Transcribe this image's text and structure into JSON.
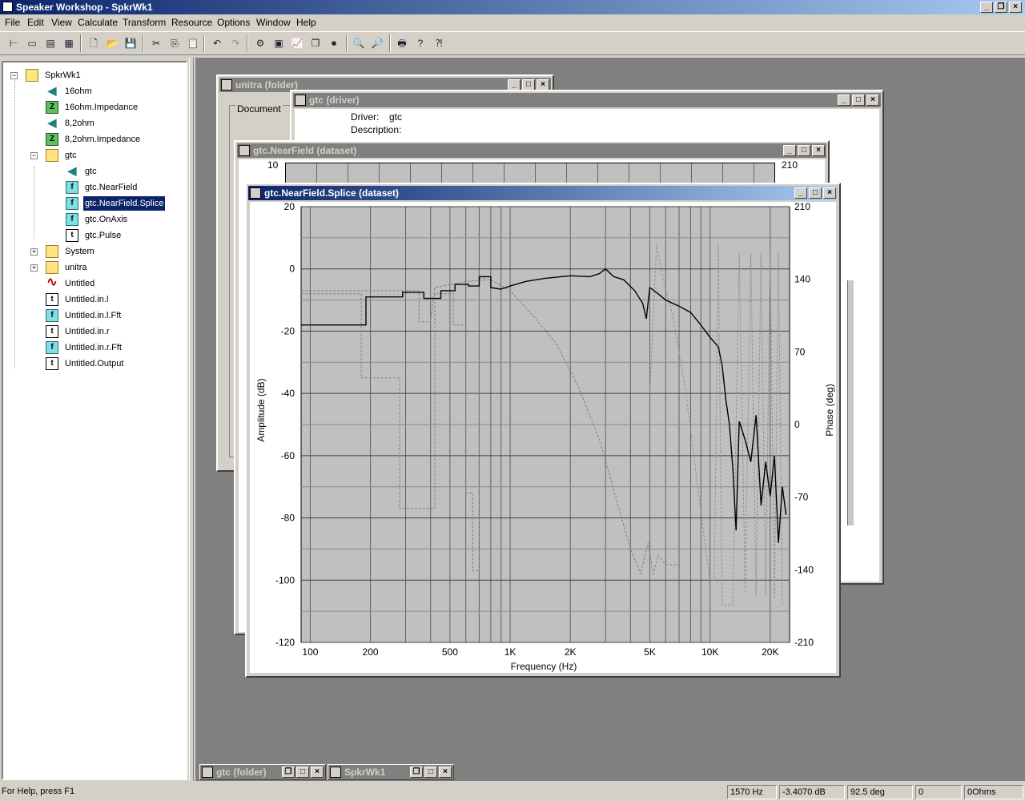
{
  "app": {
    "title": "Speaker Workshop - SpkrWk1"
  },
  "menu": [
    "File",
    "Edit",
    "View",
    "Calculate",
    "Transform",
    "Resource",
    "Options",
    "Window",
    "Help"
  ],
  "caption_buttons": {
    "min": "_",
    "max": "□",
    "close": "×",
    "restore": "❐"
  },
  "toolbar_icons": [
    "tree-view-icon",
    "list-view-icon",
    "details-view-icon",
    "small-icons-icon",
    "new-file-icon",
    "open-file-icon",
    "save-icon",
    "cut-icon",
    "copy-icon",
    "paste-icon",
    "undo-icon",
    "redo-icon",
    "calculate-icon",
    "measure-icon",
    "graph-icon",
    "windows-icon",
    "record-icon",
    "zoom-in-icon",
    "zoom-out-icon",
    "print-icon",
    "help-icon",
    "context-help-icon"
  ],
  "tree": {
    "root": "SpkrWk1",
    "items": [
      {
        "label": "16ohm",
        "icon": "speaker-icon"
      },
      {
        "label": "16ohm.Impedance",
        "icon": "impedance-icon"
      },
      {
        "label": "8,2ohm",
        "icon": "speaker-icon"
      },
      {
        "label": "8,2ohm.Impedance",
        "icon": "impedance-icon"
      },
      {
        "label": "gtc",
        "icon": "folder-icon"
      },
      {
        "label": "gtc",
        "icon": "speaker-icon"
      },
      {
        "label": "gtc.NearField",
        "icon": "frequency-icon"
      },
      {
        "label": "gtc.NearField.Splice",
        "icon": "frequency-icon"
      },
      {
        "label": "gtc.OnAxis",
        "icon": "frequency-icon"
      },
      {
        "label": "gtc.Pulse",
        "icon": "time-icon"
      },
      {
        "label": "System",
        "icon": "folder-icon"
      },
      {
        "label": "unitra",
        "icon": "folder-icon"
      },
      {
        "label": "Untitled",
        "icon": "signal-icon"
      },
      {
        "label": "Untitled.in.l",
        "icon": "time-icon"
      },
      {
        "label": "Untitled.in.l.Fft",
        "icon": "frequency-icon"
      },
      {
        "label": "Untitled.in.r",
        "icon": "time-icon"
      },
      {
        "label": "Untitled.in.r.Fft",
        "icon": "frequency-icon"
      },
      {
        "label": "Untitled.Output",
        "icon": "time-icon"
      }
    ],
    "icon_letters": {
      "z": "Z",
      "f": "f",
      "t": "t",
      "spk": "◀",
      "wave": "∿"
    }
  },
  "windows": {
    "unitra": {
      "title": "unitra (folder)",
      "group_label": "Document"
    },
    "driver": {
      "title": "gtc (driver)",
      "driver_label": "Driver:",
      "driver_value": "gtc",
      "description_label": "Description:"
    },
    "nearfield": {
      "title": "gtc.NearField (dataset)",
      "y_top": "10",
      "phase_top": "210"
    },
    "splice": {
      "title": "gtc.NearField.Splice (dataset)"
    }
  },
  "chart_data": {
    "type": "line",
    "xlabel": "Frequency (Hz)",
    "ylabel": "Amplitude (dB)",
    "y2label": "Phase (deg)",
    "x_scale": "log",
    "xlim": [
      90,
      25000
    ],
    "ylim": [
      -120,
      20
    ],
    "y2lim": [
      -210,
      210
    ],
    "x_ticks": [
      {
        "v": 100,
        "l": "100"
      },
      {
        "v": 200,
        "l": "200"
      },
      {
        "v": 500,
        "l": "500"
      },
      {
        "v": 1000,
        "l": "1K"
      },
      {
        "v": 2000,
        "l": "2K"
      },
      {
        "v": 5000,
        "l": "5K"
      },
      {
        "v": 10000,
        "l": "10K"
      },
      {
        "v": 20000,
        "l": "20K"
      }
    ],
    "y_ticks": [
      "20",
      "0",
      "-20",
      "-40",
      "-60",
      "-80",
      "-100",
      "-120"
    ],
    "y2_ticks": [
      "210",
      "140",
      "70",
      "0",
      "-70",
      "-140",
      "-210"
    ],
    "grid": true,
    "series": [
      {
        "style": "solid",
        "color": "#000000",
        "points": [
          [
            90,
            -18
          ],
          [
            190,
            -18
          ],
          [
            190,
            -9
          ],
          [
            290,
            -9
          ],
          [
            290,
            -7.5
          ],
          [
            370,
            -7.5
          ],
          [
            370,
            -9.5
          ],
          [
            450,
            -9.5
          ],
          [
            450,
            -7
          ],
          [
            530,
            -7
          ],
          [
            530,
            -5
          ],
          [
            620,
            -5
          ],
          [
            620,
            -5.5
          ],
          [
            700,
            -5.5
          ],
          [
            700,
            -2.5
          ],
          [
            800,
            -2.5
          ],
          [
            800,
            -6
          ],
          [
            900,
            -6.5
          ],
          [
            1000,
            -5.5
          ],
          [
            1200,
            -4
          ],
          [
            1500,
            -3
          ],
          [
            2000,
            -2.2
          ],
          [
            2500,
            -2.5
          ],
          [
            2800,
            -1.5
          ],
          [
            3000,
            0
          ],
          [
            3300,
            -2.5
          ],
          [
            3700,
            -3.5
          ],
          [
            4200,
            -7
          ],
          [
            4600,
            -11
          ],
          [
            4800,
            -16
          ],
          [
            5000,
            -6
          ],
          [
            5500,
            -8
          ],
          [
            6000,
            -10
          ],
          [
            7000,
            -12
          ],
          [
            8000,
            -14
          ],
          [
            9000,
            -18
          ],
          [
            10000,
            -22
          ],
          [
            11000,
            -25
          ],
          [
            11500,
            -31
          ],
          [
            12000,
            -42
          ],
          [
            12500,
            -50
          ],
          [
            13000,
            -64
          ],
          [
            13500,
            -84
          ],
          [
            14000,
            -49
          ],
          [
            15000,
            -55
          ],
          [
            16000,
            -62
          ],
          [
            17000,
            -47
          ],
          [
            18000,
            -76
          ],
          [
            19000,
            -62
          ],
          [
            20000,
            -73
          ],
          [
            21000,
            -60
          ],
          [
            22000,
            -88
          ],
          [
            23000,
            -70
          ],
          [
            24000,
            -79
          ]
        ]
      },
      {
        "style": "dashed",
        "color": "#808080",
        "points": [
          [
            90,
            -7
          ],
          [
            160,
            -7
          ],
          [
            350,
            -7
          ],
          [
            350,
            -17
          ],
          [
            400,
            -17
          ],
          [
            420,
            -6
          ],
          [
            600,
            -4
          ],
          [
            800,
            -3.5
          ],
          [
            1000,
            -7
          ],
          [
            1300,
            -15
          ],
          [
            1700,
            -24
          ],
          [
            2200,
            -38
          ],
          [
            2800,
            -55
          ],
          [
            3400,
            -74
          ],
          [
            4000,
            -90
          ],
          [
            4500,
            -98
          ],
          [
            4900,
            -88
          ],
          [
            5200,
            -98
          ],
          [
            5500,
            -92
          ],
          [
            6000,
            -95
          ],
          [
            7000,
            -95
          ]
        ]
      },
      {
        "style": "dashed",
        "color": "#808080",
        "points": [
          [
            90,
            -8
          ],
          [
            180,
            -8
          ],
          [
            180,
            -35
          ],
          [
            280,
            -35
          ],
          [
            280,
            -77
          ],
          [
            420,
            -77
          ],
          [
            420,
            -8
          ],
          [
            520,
            -8
          ],
          [
            520,
            -18
          ],
          [
            600,
            -18
          ],
          [
            600,
            -72
          ],
          [
            650,
            -72
          ],
          [
            650,
            -97
          ],
          [
            700,
            -97
          ],
          [
            700,
            -3
          ],
          [
            750,
            -3
          ]
        ]
      },
      {
        "style": "dashed",
        "color": "#909090",
        "points": [
          [
            5000,
            -40
          ],
          [
            5400,
            8
          ],
          [
            5800,
            -3
          ],
          [
            6500,
            -15
          ],
          [
            7500,
            -38
          ],
          [
            8500,
            -65
          ],
          [
            9500,
            -90
          ],
          [
            10000,
            -100
          ],
          [
            10500,
            -100
          ],
          [
            11000,
            8
          ],
          [
            11500,
            -108
          ],
          [
            12500,
            -108
          ],
          [
            13000,
            -108
          ],
          [
            14000,
            5
          ],
          [
            15000,
            -104
          ],
          [
            16000,
            5
          ],
          [
            17000,
            -105
          ],
          [
            18000,
            5
          ],
          [
            19000,
            -105
          ],
          [
            20000,
            5
          ],
          [
            21000,
            -106
          ],
          [
            22000,
            5
          ],
          [
            23000,
            -108
          ]
        ]
      }
    ]
  },
  "taskbar": {
    "gtc_folder": "gtc (folder)",
    "spkrwk1": "SpkrWk1"
  },
  "status": {
    "help": "For Help, press F1",
    "frequency": "1570 Hz",
    "amplitude": "-3.4070 dB",
    "phase": "92.5 deg",
    "value": "0",
    "ohms": "0Ohms"
  }
}
